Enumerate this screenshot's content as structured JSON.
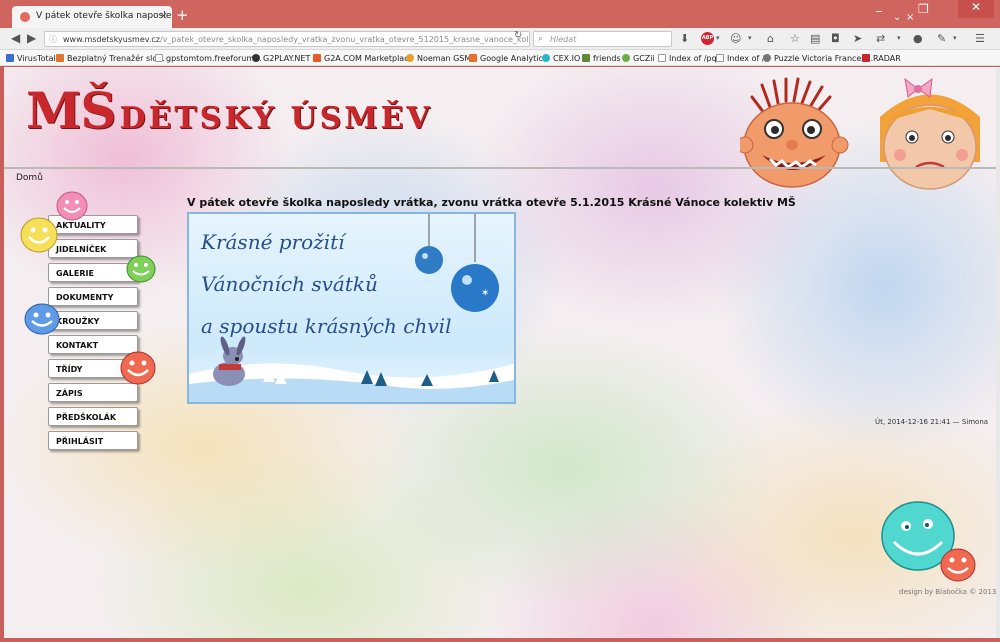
{
  "browser": {
    "tab_title": "V pátek otevře školka naposledy v...",
    "url_host": "www.msdetskyusmev.cz",
    "url_path": "/v_patek_otevre_skolka_naposledy_vratka_zvonu_vratka_otevre_512015_krasne_vanoce_kolektiv_ms",
    "search_placeholder": "Hledat",
    "bookmarks": [
      "VirusTotal",
      "Bezplatný Trenažér slo...",
      "gpstomtom.freeforum...",
      "G2PLAY.NET",
      "G2A.COM Marketplace",
      "Noeman GSM",
      "Google Analytics",
      "CEX.IO",
      "friends",
      "GCZii",
      "Index of /pq",
      "Index of /",
      "Puzzle Victoria Frances...",
      "RADAR"
    ]
  },
  "site": {
    "logo_big": "MŠ",
    "logo_small": "DĚTSKÝ ÚSMĚV",
    "breadcrumb": "Domů"
  },
  "menu": [
    "AKTUALITY",
    "JIDELNÍČEK",
    "GALERIE",
    "DOKUMENTY",
    "KROUŽKY",
    "KONTAKT",
    "TŘÍDY",
    "ZÁPIS",
    "PŘEDŠKOLÁK",
    "PŘIHLÁSIT"
  ],
  "post": {
    "title": "V pátek otevře školka naposledy vrátka, zvonu vrátka otevře 5.1.2015 Krásné Vánoce kolektiv MŠ",
    "image_lines": [
      "Krásné prožití",
      "Vánočních svátků",
      "a spoustu krásných chvil"
    ],
    "meta": "Út, 2014-12-16 21:41 — Simona"
  },
  "footer": {
    "credit": "design by Blabočka © 2013"
  },
  "colors": {
    "logo_red": "#c8282b",
    "chrome_titlebar": "#d0645e",
    "image_text_blue": "#274f8c"
  }
}
